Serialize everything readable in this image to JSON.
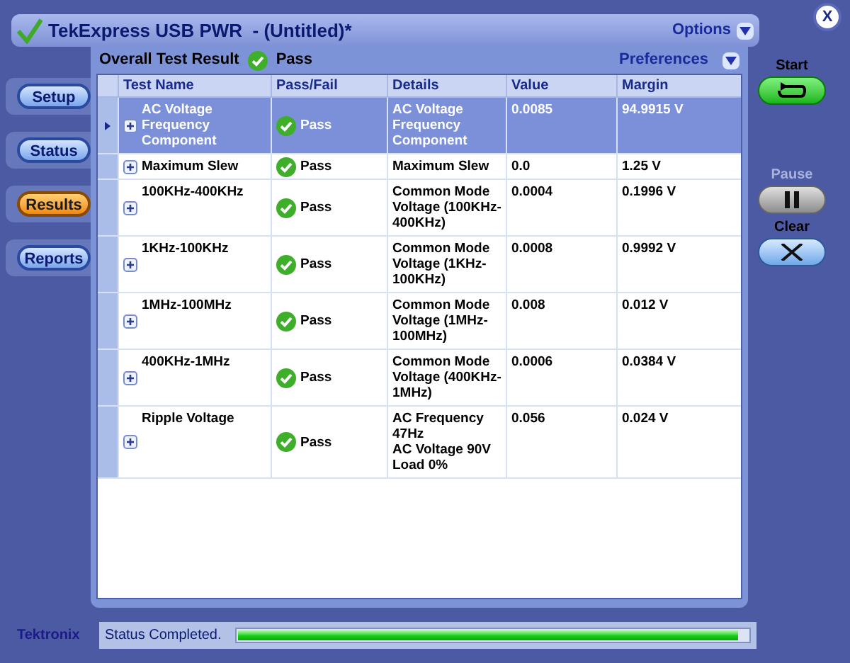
{
  "window": {
    "title": "TekExpress USB PWR  - (Untitled)*",
    "options": "Options",
    "close": "X"
  },
  "overall": {
    "label": "Overall Test Result",
    "result": "Pass",
    "passed": true
  },
  "preferences": "Preferences",
  "nav": [
    {
      "label": "Setup",
      "selected": false
    },
    {
      "label": "Status",
      "selected": false
    },
    {
      "label": "Results",
      "selected": true
    },
    {
      "label": "Reports",
      "selected": false
    }
  ],
  "table": {
    "columns": [
      "Test Name",
      "Pass/Fail",
      "Details",
      "Value",
      "Margin"
    ],
    "rows": [
      {
        "name": "AC Voltage Frequency Component",
        "result": "Pass",
        "passed": true,
        "details": [
          "AC Voltage Frequency Component"
        ],
        "value": "0.0085",
        "margin": "94.9915 V",
        "selected": true
      },
      {
        "name": "Maximum Slew",
        "result": "Pass",
        "passed": true,
        "details": [
          "Maximum Slew"
        ],
        "value": "0.0",
        "margin": "1.25 V",
        "selected": false
      },
      {
        "name": "100KHz-400KHz",
        "result": "Pass",
        "passed": true,
        "details": [
          "Common Mode Voltage (100KHz-400KHz)"
        ],
        "value": "0.0004",
        "margin": "0.1996 V",
        "selected": false
      },
      {
        "name": "1KHz-100KHz",
        "result": "Pass",
        "passed": true,
        "details": [
          "Common Mode Voltage (1KHz-100KHz)"
        ],
        "value": "0.0008",
        "margin": "0.9992 V",
        "selected": false
      },
      {
        "name": "1MHz-100MHz",
        "result": "Pass",
        "passed": true,
        "details": [
          "Common Mode Voltage (1MHz-100MHz)"
        ],
        "value": "0.008",
        "margin": "0.012 V",
        "selected": false
      },
      {
        "name": "400KHz-1MHz",
        "result": "Pass",
        "passed": true,
        "details": [
          "Common Mode Voltage (400KHz-1MHz)"
        ],
        "value": "0.0006",
        "margin": "0.0384 V",
        "selected": false
      },
      {
        "name": "Ripple Voltage",
        "result": "Pass",
        "passed": true,
        "details": [
          "AC Frequency 47Hz",
          "AC Voltage 90V",
          "Load 0%"
        ],
        "value": "0.056",
        "margin": "0.024 V",
        "selected": false
      }
    ]
  },
  "controls": [
    {
      "label": "Start",
      "kind": "start",
      "disabled": false
    },
    {
      "label": "Pause",
      "kind": "pause",
      "disabled": true
    },
    {
      "label": "Clear",
      "kind": "clear",
      "disabled": false
    }
  ],
  "brand": "Tektronix",
  "status": {
    "text": "Status Completed.",
    "level": 1
  }
}
